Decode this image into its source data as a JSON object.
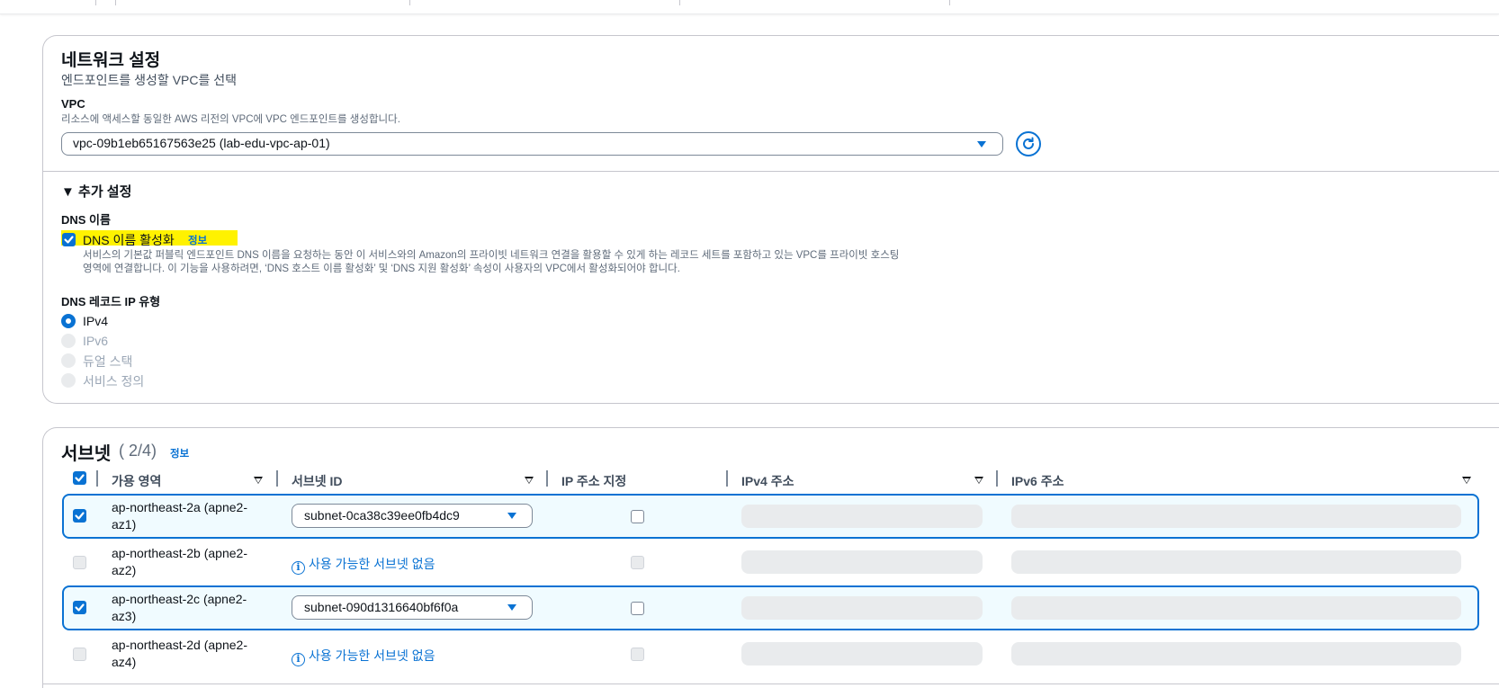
{
  "network": {
    "title": "네트워크 설정",
    "description": "엔드포인트를 생성할 VPC를 선택",
    "vpc_label": "VPC",
    "vpc_help": "리소스에 액세스할 동일한 AWS 리전의 VPC에 VPC 엔드포인트를 생성합니다.",
    "vpc_value": "vpc-09b1eb65167563e25 (lab-edu-vpc-ap-01)",
    "additional_settings": "▼ 추가 설정",
    "dns_name_label": "DNS 이름",
    "dns_enable_label": "DNS 이름 활성화",
    "info_link": "정보",
    "dns_enable_help_line1": "서비스의 기본값 퍼블릭 엔드포인트 DNS 이름을 요청하는 동안 이 서비스와의 Amazon의 프라이빗 네트워크 연결을 활용할 수 있게 하는 레코드 세트를 포함하고 있는 VPC를 프라이빗 호스팅",
    "dns_enable_help_line2": "영역에 연결합니다. 이 기능을 사용하려면, ‘DNS 호스트 이름 활성화’ 및 ‘DNS 지원 활성화’ 속성이 사용자의 VPC에서 활성화되어야 합니다.",
    "dns_record_label": "DNS 레코드 IP 유형",
    "radio_options": [
      "IPv4",
      "IPv6",
      "듀얼 스택",
      "서비스 정의"
    ],
    "selected_radio": "IPv4"
  },
  "subnets": {
    "title": "서브넷",
    "count": "( 2/4)",
    "info_link": "정보",
    "columns": [
      "가용 영역",
      "서브넷 ID",
      "IP 주소 지정",
      "IPv4 주소",
      "IPv6 주소"
    ],
    "rows": [
      {
        "az_line1": "ap-northeast-2a (apne2-",
        "az_line2": "az1)",
        "selected": true,
        "subnet": "subnet-0ca38c39ee0fb4dc9"
      },
      {
        "az_line1": "ap-northeast-2b (apne2-",
        "az_line2": "az2)",
        "selected": false,
        "subnet": "사용 가능한 서브넷 없음"
      },
      {
        "az_line1": "ap-northeast-2c (apne2-",
        "az_line2": "az3)",
        "selected": true,
        "subnet": "subnet-090d1316640bf6f0a"
      },
      {
        "az_line1": "ap-northeast-2d (apne2-",
        "az_line2": "az4)",
        "selected": false,
        "subnet": "사용 가능한 서브넷 없음"
      }
    ]
  },
  "colors": {
    "accent": "#0972d3",
    "highlight": "#fff200",
    "selected_row_bg": "#f0fbff"
  }
}
